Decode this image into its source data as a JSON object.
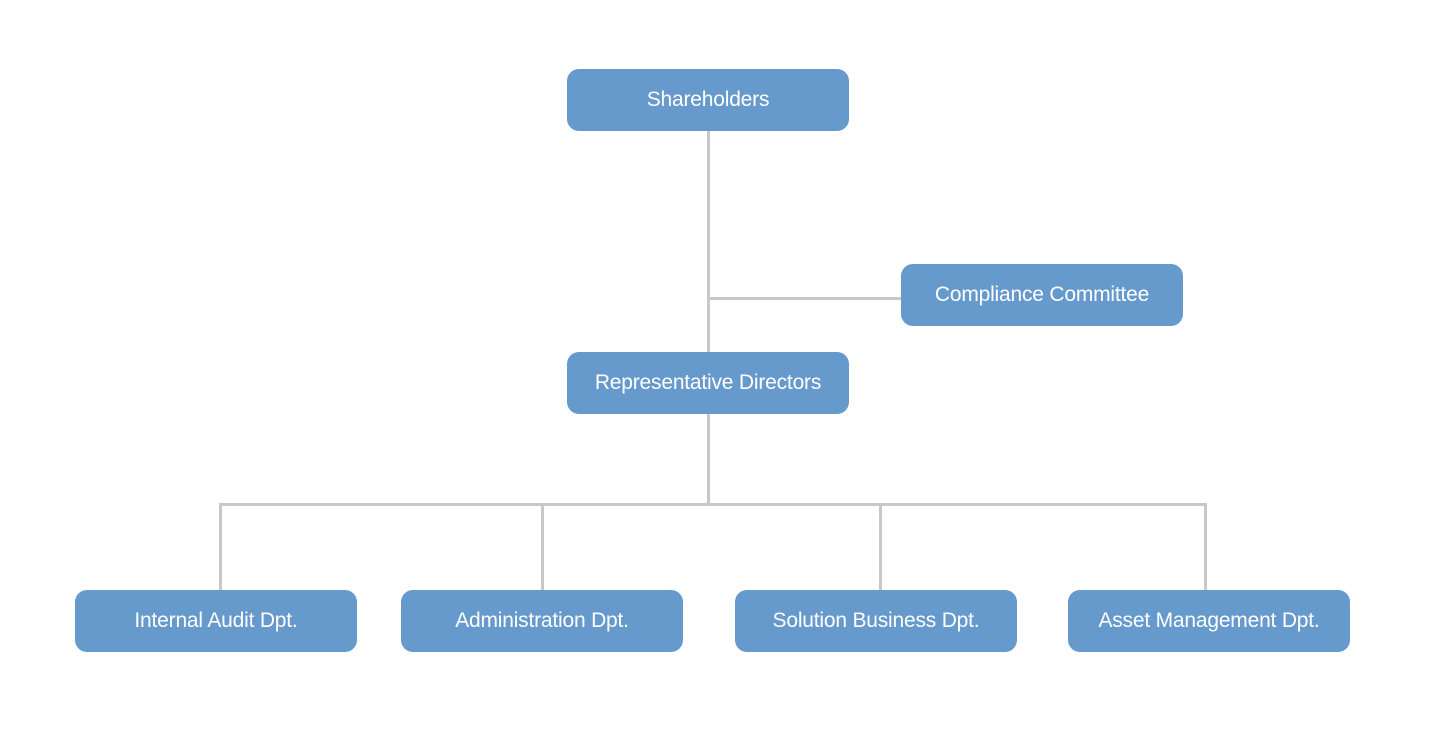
{
  "diagram": {
    "type": "organization-chart",
    "colors": {
      "box_fill": "#6699cc",
      "box_text": "#ffffff",
      "connector": "#c8c8c8",
      "background": "#ffffff"
    },
    "nodes": {
      "shareholders": "Shareholders",
      "compliance": "Compliance Committee",
      "directors": "Representative Directors",
      "departments": [
        "Internal Audit Dpt.",
        "Administration Dpt.",
        "Solution Business Dpt.",
        "Asset Management Dpt."
      ]
    },
    "edges": [
      [
        "Shareholders",
        "Representative Directors"
      ],
      [
        "Compliance Committee",
        "Shareholders-Directors link"
      ],
      [
        "Representative Directors",
        "Internal Audit Dpt."
      ],
      [
        "Representative Directors",
        "Administration Dpt."
      ],
      [
        "Representative Directors",
        "Solution Business Dpt."
      ],
      [
        "Representative Directors",
        "Asset Management Dpt."
      ]
    ]
  }
}
